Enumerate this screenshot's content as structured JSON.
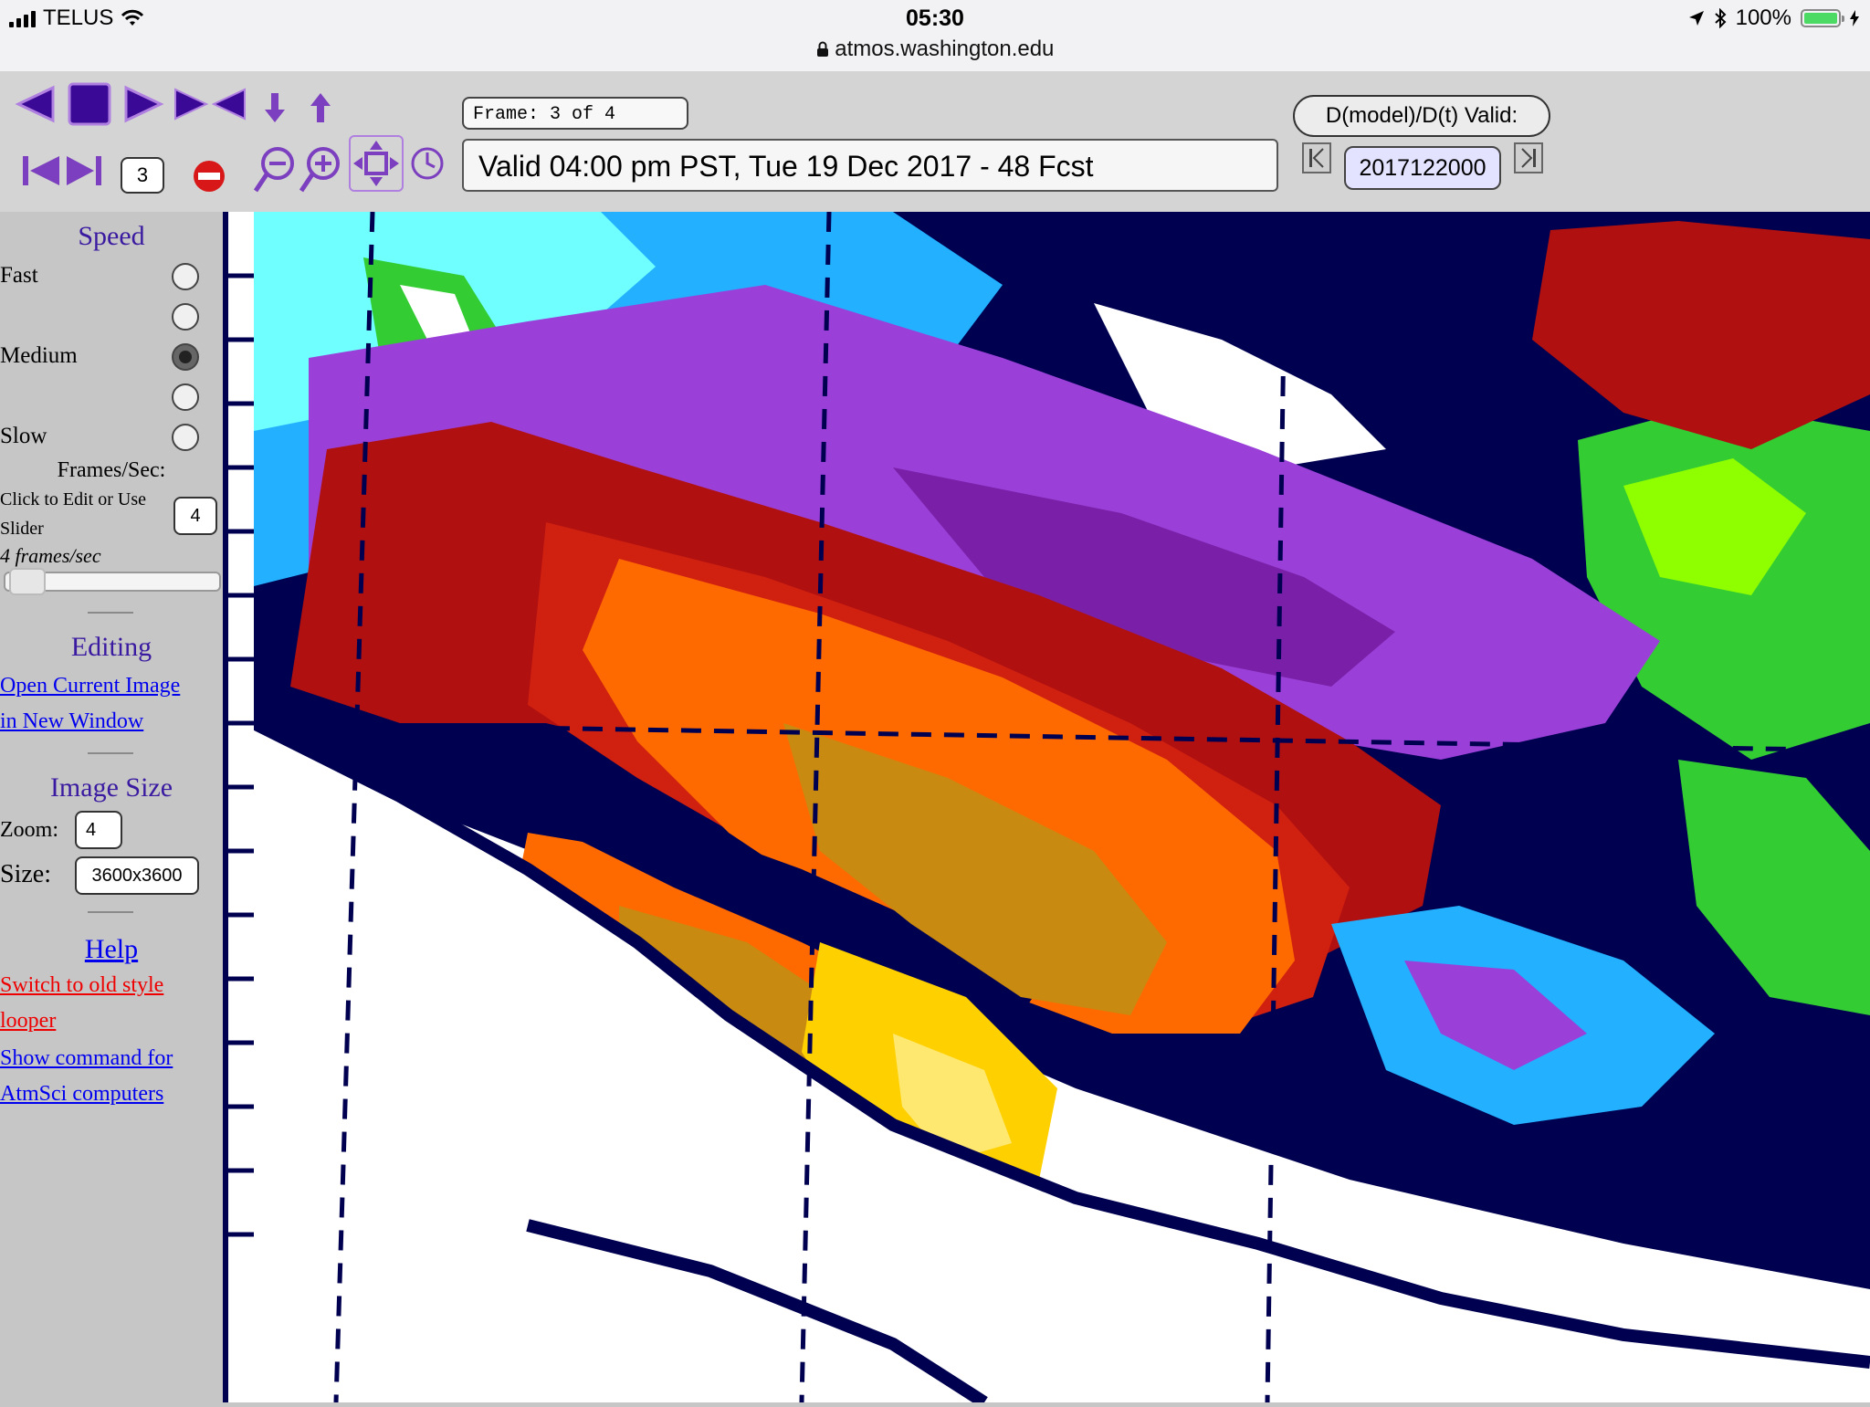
{
  "status_bar": {
    "carrier": "TELUS",
    "time": "05:30",
    "url": "atmos.washington.edu",
    "battery": "100%"
  },
  "toolbar": {
    "frame_label": "Frame: 3 of 4",
    "valid_time": "Valid 04:00 pm PST, Tue 19 Dec 2017 - 48 Fcst",
    "ddt_button": "D(model)/D(t) Valid:",
    "date_value": "2017122000",
    "frame_jump_value": "3",
    "accent_color": "#3a0a96",
    "icon_color": "#7b3fbf"
  },
  "sidebar": {
    "speed_title": "Speed",
    "speed_options": [
      "Fast",
      "",
      "Medium",
      "",
      "Slow"
    ],
    "speed_selected": "Medium",
    "fps_title": "Frames/Sec:",
    "fps_help_line1": "Click to Edit or Use",
    "fps_help_line2": "Slider",
    "fps_value": "4",
    "fps_status": "4 frames/sec",
    "fps_slider_fraction": 0.0,
    "editing_title": "Editing",
    "open_image_line1": "Open Current Image",
    "open_image_line2": "in New Window",
    "image_size_title": "Image Size",
    "zoom_label": "Zoom:",
    "zoom_value": "4",
    "size_label": "Size:",
    "size_value": "3600x3600",
    "help_link": "Help",
    "old_style_line1": "Switch to old style",
    "old_style_line2": "looper",
    "command_line1": "Show command for",
    "command_line2": "AtmSci computers"
  },
  "map": {
    "palette": [
      "#ffffff",
      "#000050",
      "#33cc33",
      "#8fff00",
      "#22b0ff",
      "#6fffff",
      "#9a40d8",
      "#7a20a8",
      "#b01010",
      "#d02010",
      "#ff6a00",
      "#c88a10",
      "#ffd000"
    ]
  }
}
